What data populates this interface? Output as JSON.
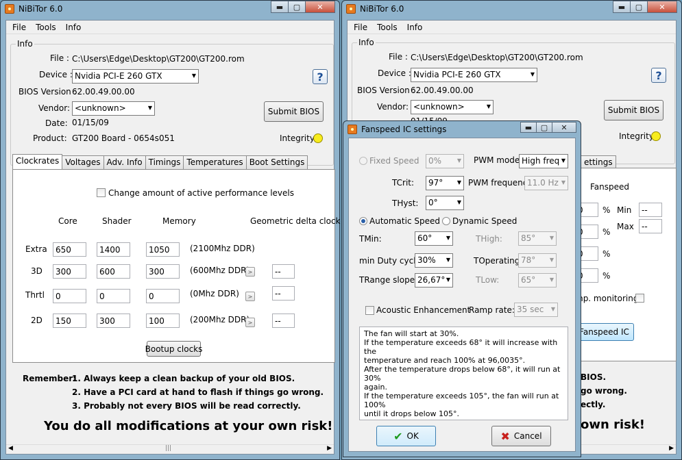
{
  "app": {
    "title": "NiBiTor 6.0",
    "menu": [
      "File",
      "Tools",
      "Info"
    ],
    "window_controls": {
      "minimize": "▬",
      "maximize": "▢",
      "close": "✕"
    }
  },
  "info": {
    "group_label": "Info",
    "file_label": "File :",
    "file_value": "C:\\Users\\Edge\\Desktop\\GT200\\GT200.rom",
    "device_label": "Device :",
    "device_value": "Nvidia PCI-E 260 GTX",
    "bios_version_label": "BIOS Version :",
    "bios_version_value": "62.00.49.00.00",
    "vendor_label": "Vendor:",
    "vendor_value": "<unknown>",
    "date_label": "Date:",
    "date_value": "01/15/09",
    "product_label": "Product:",
    "product_value": "GT200 Board - 0654s051",
    "help_button": "?",
    "submit_bios": "Submit BIOS",
    "integrity_label": "Integrity :"
  },
  "tabs": [
    "Clockrates",
    "Voltages",
    "Adv. Info",
    "Timings",
    "Temperatures",
    "Boot Settings"
  ],
  "clockrates": {
    "change_levels_label": "Change amount of active performance levels",
    "headers": {
      "core": "Core",
      "shader": "Shader",
      "memory": "Memory",
      "delta": "Geometric delta clock"
    },
    "rows": [
      {
        "name": "Extra",
        "core": "650",
        "shader": "1400",
        "memory": "1050",
        "note": "(2100Mhz DDR)",
        "delta": ""
      },
      {
        "name": "3D",
        "core": "300",
        "shader": "600",
        "memory": "300",
        "note": "(600Mhz DDR)",
        "delta": "--"
      },
      {
        "name": "Thrtl",
        "core": "0",
        "shader": "0",
        "memory": "0",
        "note": "(0Mhz DDR)",
        "delta": "--"
      },
      {
        "name": "2D",
        "core": "150",
        "shader": "300",
        "memory": "100",
        "note": "(200Mhz DDR)",
        "delta": "--"
      }
    ],
    "bootup_button": "Bootup clocks"
  },
  "remember": {
    "label": "Remember:",
    "items": [
      "1. Always keep a clean backup of your old BIOS.",
      "2. Have a PCI card at hand to flash if things go wrong.",
      "3. Probably not every BIOS will be read correctly."
    ],
    "warning": "You do all modifications at your own risk!"
  },
  "right_window": {
    "tab_fragment": "ettings",
    "fanspeed_label": "Fanspeed",
    "pct": "%",
    "min_label": "Min",
    "max_label": "Max",
    "min_value": "--",
    "max_value": "--",
    "row_values": [
      "0",
      "0",
      "0",
      "0"
    ],
    "temp_monitoring": "mp. monitoring:",
    "fanspeed_ic_button": "Fanspeed IC",
    "remember_fragments": [
      "BIOS.",
      "go wrong.",
      "ectly."
    ],
    "warning_fragment": "own risk!",
    "date_fragment": "01/15/09"
  },
  "dialog": {
    "title": "Fanspeed IC settings",
    "fixed_speed_label": "Fixed Speed",
    "fixed_speed_value": "0%",
    "pwm_mode_label": "PWM mode:",
    "pwm_mode_value": "High freq",
    "tcrit_label": "TCrit:",
    "tcrit_value": "97°",
    "pwm_freq_label": "PWM frequency:",
    "pwm_freq_value": "11.0 Hz",
    "thyst_label": "THyst:",
    "thyst_value": "0°",
    "automatic_speed": "Automatic Speed",
    "dynamic_speed": "Dynamic Speed",
    "tmin_label": "TMin:",
    "tmin_value": "60°",
    "thigh_label": "THigh:",
    "thigh_value": "85°",
    "min_duty_label": "min Duty cycle:",
    "min_duty_value": "30%",
    "toperating_label": "TOperating:",
    "toperating_value": "78°",
    "trange_label": "TRange slope:",
    "trange_value": "26,67°",
    "tlow_label": "TLow:",
    "tlow_value": "65°",
    "acoustic_label": "Acoustic Enhancement",
    "ramp_rate_label": "Ramp rate:",
    "ramp_rate_value": "35 sec",
    "description": [
      "The fan will start at 30%.",
      "If the temperature exceeds 68° it will increase with the",
      "temperature and reach 100% at 96,0035°.",
      "After the temperature drops below 68°, it will run at 30%",
      "again.",
      "If the temperature exceeds 105°, the fan will run at 100%",
      "until it drops below 105°."
    ],
    "ok": "OK",
    "cancel": "Cancel"
  }
}
